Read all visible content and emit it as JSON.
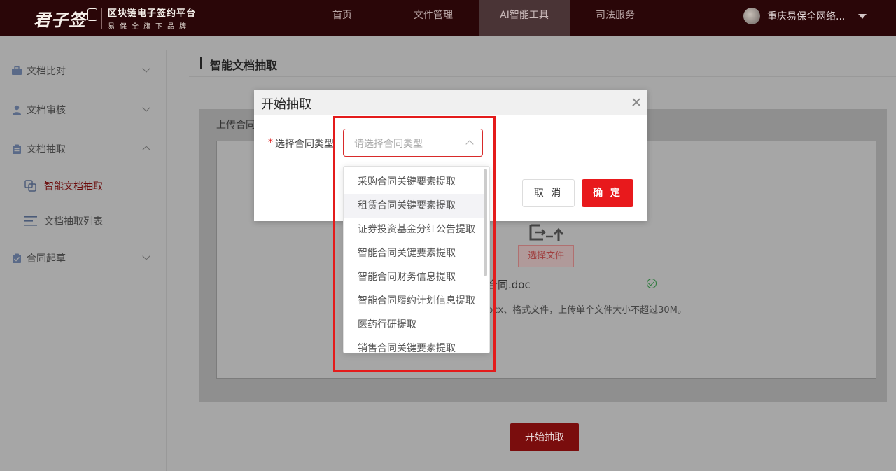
{
  "brand": {
    "logo_text": "君子签",
    "tagline": "区块链电子签约平台",
    "subline": "易保全旗下品牌"
  },
  "nav": {
    "items": [
      "首页",
      "文件管理",
      "AI智能工具",
      "司法服务"
    ],
    "active": "AI智能工具"
  },
  "user": {
    "name": "重庆易保全网络..."
  },
  "sidebar": {
    "items": [
      {
        "label": "文档比对",
        "icon": "briefcase-icon",
        "expanded": false
      },
      {
        "label": "文档审核",
        "icon": "user-icon",
        "expanded": false
      },
      {
        "label": "文档抽取",
        "icon": "clipboard-icon",
        "expanded": true
      },
      {
        "label": "合同起草",
        "icon": "clipboard-check-icon",
        "expanded": false
      }
    ],
    "subitems": [
      {
        "label": "智能文档抽取",
        "icon": "copy-icon",
        "active": true
      },
      {
        "label": "文档抽取列表",
        "icon": "list-icon",
        "active": false
      }
    ]
  },
  "main": {
    "title": "智能文档抽取",
    "upload_label": "上传合同",
    "choose_file": "选择文件",
    "file_name": "合同.doc",
    "hint": "pcx、格式文件，上传单个文件大小不超过30M。",
    "start_button": "开始抽取"
  },
  "modal": {
    "title": "开始抽取",
    "required_mark": "*",
    "field_label": "选择合同类型",
    "placeholder": "请选择合同类型",
    "cancel": "取 消",
    "confirm": "确 定"
  },
  "dropdown": {
    "options": [
      "采购合同关键要素提取",
      "租赁合同关键要素提取",
      "证券投资基金分红公告提取",
      "智能合同关键要素提取",
      "智能合同财务信息提取",
      "智能合同履约计划信息提取",
      "医药行研提取",
      "销售合同关键要素提取"
    ],
    "hovered_index": 1
  },
  "colors": {
    "topbar": "#2a0608",
    "accent": "#e8191c",
    "highlight": "#e41b1b"
  }
}
